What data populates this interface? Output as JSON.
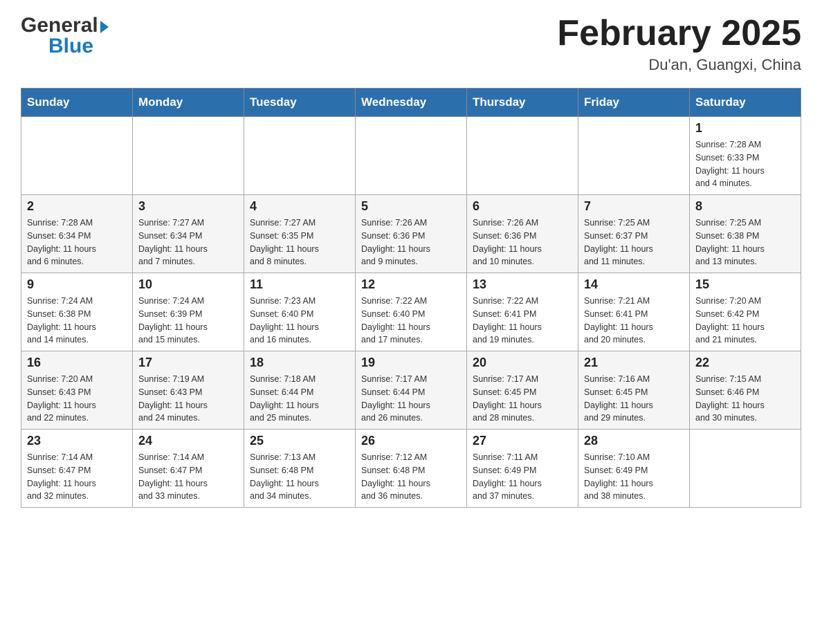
{
  "header": {
    "logo_general": "General",
    "logo_blue": "Blue",
    "title": "February 2025",
    "location": "Du'an, Guangxi, China"
  },
  "weekdays": [
    "Sunday",
    "Monday",
    "Tuesday",
    "Wednesday",
    "Thursday",
    "Friday",
    "Saturday"
  ],
  "weeks": [
    [
      {
        "day": "",
        "info": ""
      },
      {
        "day": "",
        "info": ""
      },
      {
        "day": "",
        "info": ""
      },
      {
        "day": "",
        "info": ""
      },
      {
        "day": "",
        "info": ""
      },
      {
        "day": "",
        "info": ""
      },
      {
        "day": "1",
        "info": "Sunrise: 7:28 AM\nSunset: 6:33 PM\nDaylight: 11 hours\nand 4 minutes."
      }
    ],
    [
      {
        "day": "2",
        "info": "Sunrise: 7:28 AM\nSunset: 6:34 PM\nDaylight: 11 hours\nand 6 minutes."
      },
      {
        "day": "3",
        "info": "Sunrise: 7:27 AM\nSunset: 6:34 PM\nDaylight: 11 hours\nand 7 minutes."
      },
      {
        "day": "4",
        "info": "Sunrise: 7:27 AM\nSunset: 6:35 PM\nDaylight: 11 hours\nand 8 minutes."
      },
      {
        "day": "5",
        "info": "Sunrise: 7:26 AM\nSunset: 6:36 PM\nDaylight: 11 hours\nand 9 minutes."
      },
      {
        "day": "6",
        "info": "Sunrise: 7:26 AM\nSunset: 6:36 PM\nDaylight: 11 hours\nand 10 minutes."
      },
      {
        "day": "7",
        "info": "Sunrise: 7:25 AM\nSunset: 6:37 PM\nDaylight: 11 hours\nand 11 minutes."
      },
      {
        "day": "8",
        "info": "Sunrise: 7:25 AM\nSunset: 6:38 PM\nDaylight: 11 hours\nand 13 minutes."
      }
    ],
    [
      {
        "day": "9",
        "info": "Sunrise: 7:24 AM\nSunset: 6:38 PM\nDaylight: 11 hours\nand 14 minutes."
      },
      {
        "day": "10",
        "info": "Sunrise: 7:24 AM\nSunset: 6:39 PM\nDaylight: 11 hours\nand 15 minutes."
      },
      {
        "day": "11",
        "info": "Sunrise: 7:23 AM\nSunset: 6:40 PM\nDaylight: 11 hours\nand 16 minutes."
      },
      {
        "day": "12",
        "info": "Sunrise: 7:22 AM\nSunset: 6:40 PM\nDaylight: 11 hours\nand 17 minutes."
      },
      {
        "day": "13",
        "info": "Sunrise: 7:22 AM\nSunset: 6:41 PM\nDaylight: 11 hours\nand 19 minutes."
      },
      {
        "day": "14",
        "info": "Sunrise: 7:21 AM\nSunset: 6:41 PM\nDaylight: 11 hours\nand 20 minutes."
      },
      {
        "day": "15",
        "info": "Sunrise: 7:20 AM\nSunset: 6:42 PM\nDaylight: 11 hours\nand 21 minutes."
      }
    ],
    [
      {
        "day": "16",
        "info": "Sunrise: 7:20 AM\nSunset: 6:43 PM\nDaylight: 11 hours\nand 22 minutes."
      },
      {
        "day": "17",
        "info": "Sunrise: 7:19 AM\nSunset: 6:43 PM\nDaylight: 11 hours\nand 24 minutes."
      },
      {
        "day": "18",
        "info": "Sunrise: 7:18 AM\nSunset: 6:44 PM\nDaylight: 11 hours\nand 25 minutes."
      },
      {
        "day": "19",
        "info": "Sunrise: 7:17 AM\nSunset: 6:44 PM\nDaylight: 11 hours\nand 26 minutes."
      },
      {
        "day": "20",
        "info": "Sunrise: 7:17 AM\nSunset: 6:45 PM\nDaylight: 11 hours\nand 28 minutes."
      },
      {
        "day": "21",
        "info": "Sunrise: 7:16 AM\nSunset: 6:45 PM\nDaylight: 11 hours\nand 29 minutes."
      },
      {
        "day": "22",
        "info": "Sunrise: 7:15 AM\nSunset: 6:46 PM\nDaylight: 11 hours\nand 30 minutes."
      }
    ],
    [
      {
        "day": "23",
        "info": "Sunrise: 7:14 AM\nSunset: 6:47 PM\nDaylight: 11 hours\nand 32 minutes."
      },
      {
        "day": "24",
        "info": "Sunrise: 7:14 AM\nSunset: 6:47 PM\nDaylight: 11 hours\nand 33 minutes."
      },
      {
        "day": "25",
        "info": "Sunrise: 7:13 AM\nSunset: 6:48 PM\nDaylight: 11 hours\nand 34 minutes."
      },
      {
        "day": "26",
        "info": "Sunrise: 7:12 AM\nSunset: 6:48 PM\nDaylight: 11 hours\nand 36 minutes."
      },
      {
        "day": "27",
        "info": "Sunrise: 7:11 AM\nSunset: 6:49 PM\nDaylight: 11 hours\nand 37 minutes."
      },
      {
        "day": "28",
        "info": "Sunrise: 7:10 AM\nSunset: 6:49 PM\nDaylight: 11 hours\nand 38 minutes."
      },
      {
        "day": "",
        "info": ""
      }
    ]
  ]
}
